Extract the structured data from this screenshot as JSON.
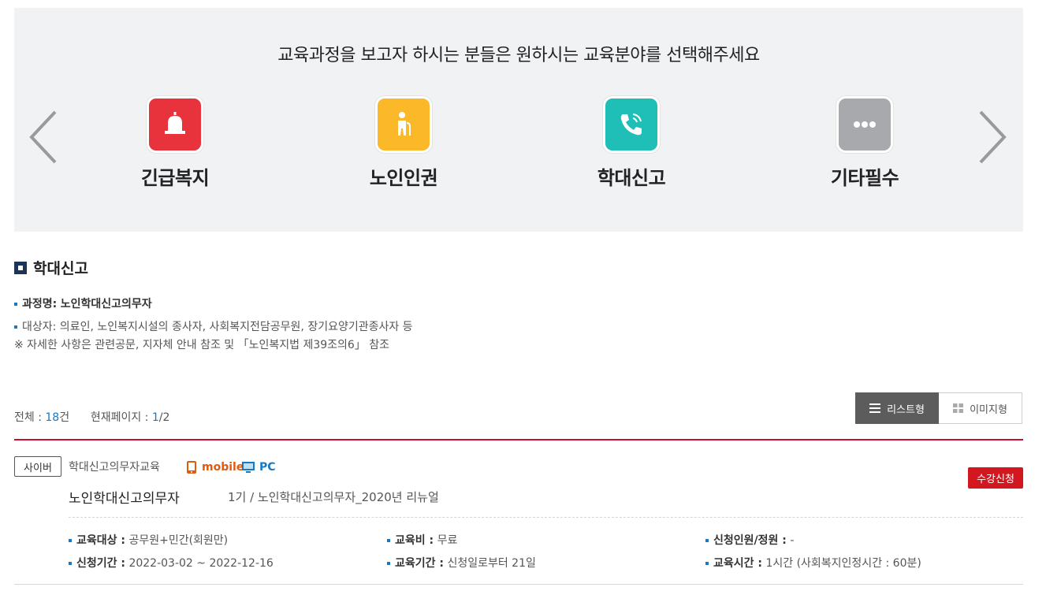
{
  "panel": {
    "title": "교육과정을 보고자 하시는 분들은 원하시는 교육분야를 선택해주세요",
    "categories": [
      {
        "label": "긴급복지",
        "color": "#e8323c",
        "icon": "alarm-bell-icon"
      },
      {
        "label": "노인인권",
        "color": "#fbb829",
        "icon": "elderly-person-icon"
      },
      {
        "label": "학대신고",
        "color": "#1fbfb8",
        "icon": "phone-call-icon"
      },
      {
        "label": "기타필수",
        "color": "#a7a9ac",
        "icon": "more-dots-icon"
      }
    ]
  },
  "section": {
    "title": "학대신고",
    "course_name_label": "과정명:",
    "course_name_value": "노인학대신고의무자",
    "target_line": "대상자: 의료인, 노인복지시설의 종사자, 사회복지전담공무원, 장기요양기관종사자 등",
    "note_line": "※ 자세한 사항은 관련공문, 지자체 안내 참조 및 「노인복지법 제39조의6」 참조"
  },
  "totals": {
    "total_label": "전체 : ",
    "total_count": "18",
    "total_unit": "건",
    "page_label": "현재페이지 : ",
    "page_current": "1",
    "page_total": "/2"
  },
  "view": {
    "list_label": "리스트형",
    "image_label": "이미지형"
  },
  "course": {
    "tag": "사이버",
    "category": "학대신고의무자교육",
    "mobile_label": "mobile",
    "pc_label": "PC",
    "apply_label": "수강신청",
    "title": "노인학대신고의무자",
    "session": "1기 / 노인학대신고의무자_2020년 리뉴얼",
    "details": {
      "target_k": "교육대상 :",
      "target_v": " 공무원+민간(회원만)",
      "fee_k": "교육비 :",
      "fee_v": " 무료",
      "quota_k": "신청인원/정원 :",
      "quota_v": " -",
      "apply_period_k": "신청기간 :",
      "apply_period_v": " 2022-03-02 ~ 2022-12-16",
      "edu_period_k": "교육기간 :",
      "edu_period_v": " 신청일로부터 21일",
      "edu_time_k": "교육시간 :",
      "edu_time_v": " 1시간 (사회복지인정시간 : 60분)"
    }
  },
  "colors": {
    "accent_red": "#c8102e",
    "accent_blue": "#1a78c2",
    "panel_bg": "#f1f2f4"
  }
}
